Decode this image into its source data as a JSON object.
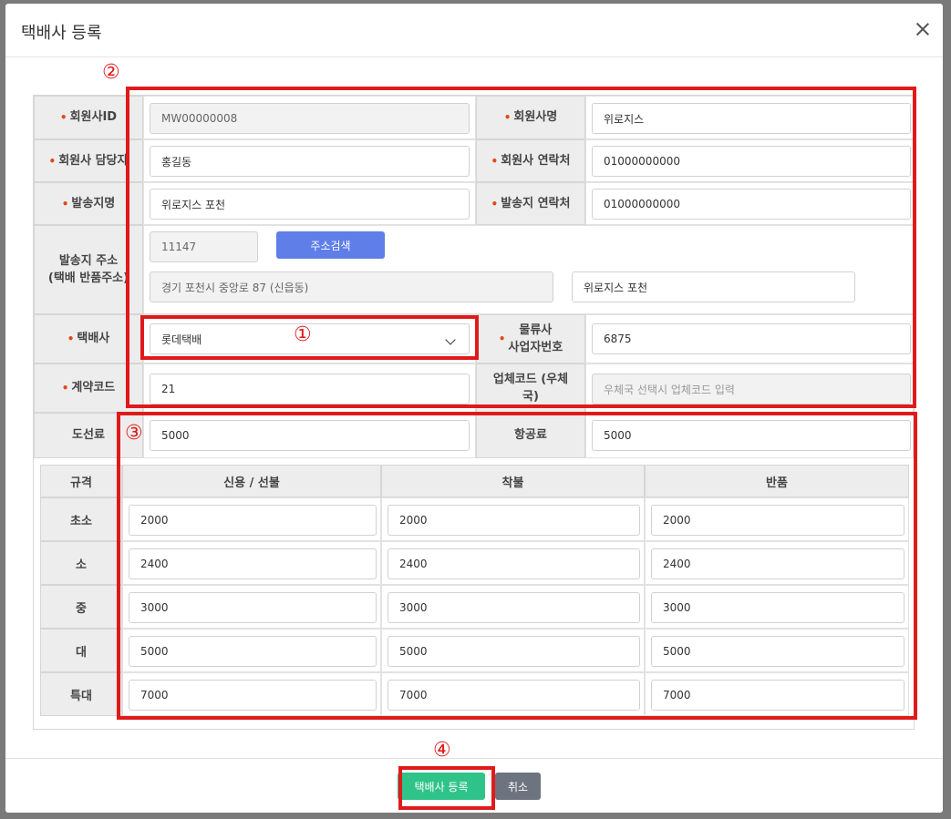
{
  "modal": {
    "title": "택배사 등록",
    "close_icon": "close-icon"
  },
  "form": {
    "member_id": {
      "label": "회원사ID",
      "value": "MW00000008"
    },
    "member_name": {
      "label": "회원사명",
      "value": "위로지스"
    },
    "member_manager": {
      "label": "회원사 담당자",
      "value": "홍길동"
    },
    "member_phone": {
      "label": "회원사 연락처",
      "value": "01000000000"
    },
    "sender_name": {
      "label": "발송지명",
      "value": "위로지스 포천"
    },
    "sender_phone": {
      "label": "발송지 연락처",
      "value": "01000000000"
    },
    "address": {
      "label": "발송지 주소\n(택배 반품주소)",
      "zipcode": "11147",
      "search_button": "주소검색",
      "address1": "경기 포천시 중앙로 87 (신읍동)",
      "address2": "위로지스 포천"
    },
    "courier": {
      "label": "택배사",
      "value": "롯데택배"
    },
    "logistics_biz_no": {
      "label": "물류사\n사업자번호",
      "value": "6875"
    },
    "contract_code": {
      "label": "계약코드",
      "value": "21"
    },
    "company_code": {
      "label": "업체코드 (우체국)",
      "placeholder": "우체국 선택시 업체코드 입력"
    },
    "island_fee": {
      "label": "도선료",
      "value": "5000"
    },
    "air_fee": {
      "label": "항공료",
      "value": "5000"
    }
  },
  "rate_table": {
    "headers": [
      "규격",
      "신용 / 선불",
      "착불",
      "반품"
    ],
    "rows": [
      {
        "size": "초소",
        "credit": "2000",
        "cod": "2000",
        "return": "2000"
      },
      {
        "size": "소",
        "credit": "2400",
        "cod": "2400",
        "return": "2400"
      },
      {
        "size": "중",
        "credit": "3000",
        "cod": "3000",
        "return": "3000"
      },
      {
        "size": "대",
        "credit": "5000",
        "cod": "5000",
        "return": "5000"
      },
      {
        "size": "특대",
        "credit": "7000",
        "cod": "7000",
        "return": "7000"
      }
    ]
  },
  "annotations": [
    "①",
    "②",
    "③",
    "④"
  ],
  "footer": {
    "submit_label": "택배사 등록",
    "cancel_label": "취소"
  },
  "colors": {
    "annotation_red": "#e01a1a",
    "submit_green": "#2fc38a",
    "search_blue": "#5f7ee8",
    "cancel_gray": "#6d7480",
    "required_dot": "#e04a1a"
  }
}
